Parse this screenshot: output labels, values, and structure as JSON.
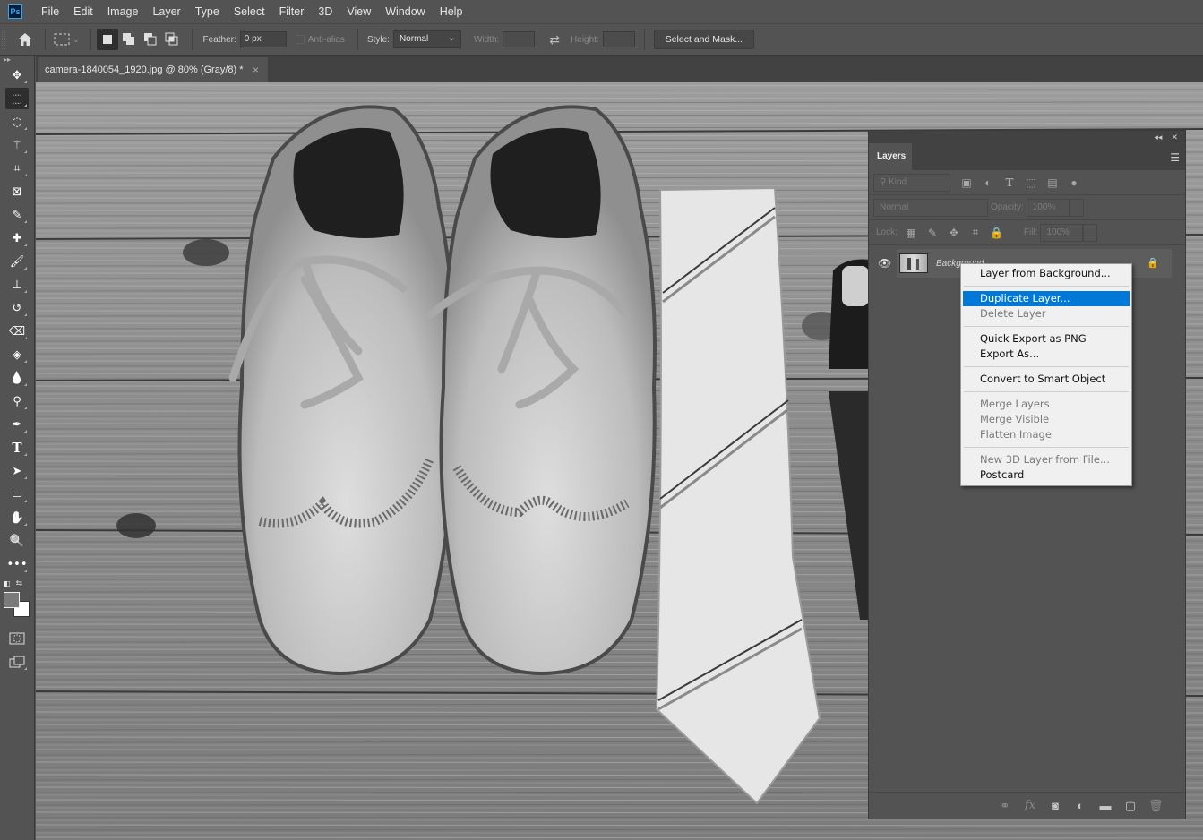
{
  "app": {
    "logo": "Ps"
  },
  "menubar": [
    "File",
    "Edit",
    "Image",
    "Layer",
    "Type",
    "Select",
    "Filter",
    "3D",
    "View",
    "Window",
    "Help"
  ],
  "options": {
    "feather_label": "Feather:",
    "feather_value": "0 px",
    "antialias_label": "Anti-alias",
    "style_label": "Style:",
    "style_value": "Normal",
    "width_label": "Width:",
    "width_value": "",
    "height_label": "Height:",
    "height_value": "",
    "select_mask_label": "Select and Mask..."
  },
  "document_tab": {
    "title": "camera-1840054_1920.jpg @ 80% (Gray/8) *",
    "close": "×"
  },
  "tools": [
    {
      "name": "move-tool",
      "glyph": "✥"
    },
    {
      "name": "rectangular-marquee-tool",
      "glyph": "⬚",
      "active": true
    },
    {
      "name": "lasso-tool",
      "glyph": "◌"
    },
    {
      "name": "magic-wand-tool",
      "glyph": "⚚"
    },
    {
      "name": "crop-tool",
      "glyph": "⌗"
    },
    {
      "name": "frame-tool",
      "glyph": "⊠"
    },
    {
      "name": "eyedropper-tool",
      "glyph": "✎"
    },
    {
      "name": "healing-brush-tool",
      "glyph": "✚"
    },
    {
      "name": "brush-tool",
      "glyph": "🖌"
    },
    {
      "name": "clone-stamp-tool",
      "glyph": "⊥"
    },
    {
      "name": "history-brush-tool",
      "glyph": "↺"
    },
    {
      "name": "eraser-tool",
      "glyph": "⌫"
    },
    {
      "name": "paint-bucket-tool",
      "glyph": "◈"
    },
    {
      "name": "blur-tool",
      "glyph": "💧"
    },
    {
      "name": "dodge-tool",
      "glyph": "⚲"
    },
    {
      "name": "pen-tool",
      "glyph": "✒"
    },
    {
      "name": "type-tool",
      "glyph": "T"
    },
    {
      "name": "path-selection-tool",
      "glyph": "➤"
    },
    {
      "name": "rectangle-tool",
      "glyph": "▭"
    },
    {
      "name": "hand-tool",
      "glyph": "✋"
    },
    {
      "name": "zoom-tool",
      "glyph": "🔍"
    },
    {
      "name": "edit-toolbar",
      "glyph": "•••"
    }
  ],
  "colors": {
    "foreground": "#7a7a7a",
    "background": "#ffffff",
    "highlight": "#0078d7"
  },
  "layers_panel": {
    "tab_label": "Layers",
    "filter_kind": "Kind",
    "blend_mode": "Normal",
    "opacity_label": "Opacity:",
    "opacity_value": "100%",
    "lock_label": "Lock:",
    "fill_label": "Fill:",
    "fill_value": "100%",
    "layers": [
      {
        "name": "Background",
        "visible": true,
        "locked": true
      }
    ]
  },
  "context_menu": {
    "groups": [
      [
        {
          "label": "Layer from Background...",
          "enabled": true
        }
      ],
      [
        {
          "label": "Duplicate Layer...",
          "enabled": true,
          "highlighted": true
        },
        {
          "label": "Delete Layer",
          "enabled": false
        }
      ],
      [
        {
          "label": "Quick Export as PNG",
          "enabled": true
        },
        {
          "label": "Export As...",
          "enabled": true
        }
      ],
      [
        {
          "label": "Convert to Smart Object",
          "enabled": true
        }
      ],
      [
        {
          "label": "Merge Layers",
          "enabled": false
        },
        {
          "label": "Merge Visible",
          "enabled": false
        },
        {
          "label": "Flatten Image",
          "enabled": false
        }
      ],
      [
        {
          "label": "New 3D Layer from File...",
          "enabled": false
        },
        {
          "label": "Postcard",
          "enabled": true
        }
      ]
    ]
  }
}
